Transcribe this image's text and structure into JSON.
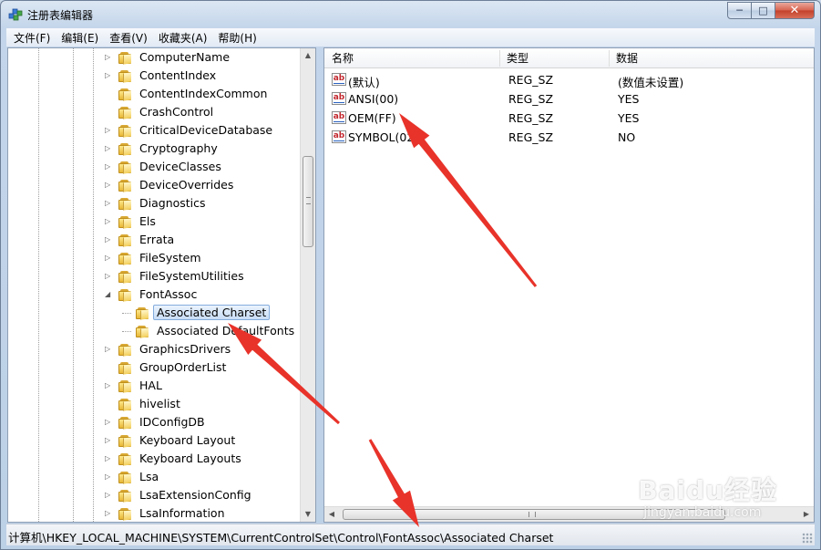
{
  "window": {
    "title": "注册表编辑器"
  },
  "menubar": [
    {
      "label": "文件(F)"
    },
    {
      "label": "编辑(E)"
    },
    {
      "label": "查看(V)"
    },
    {
      "label": "收藏夹(A)"
    },
    {
      "label": "帮助(H)"
    }
  ],
  "tree": {
    "items": [
      {
        "label": "ComputerName",
        "depth": 0,
        "expander": "collapsed"
      },
      {
        "label": "ContentIndex",
        "depth": 0,
        "expander": "collapsed"
      },
      {
        "label": "ContentIndexCommon",
        "depth": 0,
        "expander": "none"
      },
      {
        "label": "CrashControl",
        "depth": 0,
        "expander": "none"
      },
      {
        "label": "CriticalDeviceDatabase",
        "depth": 0,
        "expander": "collapsed"
      },
      {
        "label": "Cryptography",
        "depth": 0,
        "expander": "collapsed"
      },
      {
        "label": "DeviceClasses",
        "depth": 0,
        "expander": "collapsed"
      },
      {
        "label": "DeviceOverrides",
        "depth": 0,
        "expander": "collapsed"
      },
      {
        "label": "Diagnostics",
        "depth": 0,
        "expander": "collapsed"
      },
      {
        "label": "Els",
        "depth": 0,
        "expander": "collapsed"
      },
      {
        "label": "Errata",
        "depth": 0,
        "expander": "collapsed"
      },
      {
        "label": "FileSystem",
        "depth": 0,
        "expander": "collapsed"
      },
      {
        "label": "FileSystemUtilities",
        "depth": 0,
        "expander": "collapsed"
      },
      {
        "label": "FontAssoc",
        "depth": 0,
        "expander": "expanded"
      },
      {
        "label": "Associated Charset",
        "depth": 1,
        "expander": "none",
        "selected": true
      },
      {
        "label": "Associated DefaultFonts",
        "depth": 1,
        "expander": "none"
      },
      {
        "label": "GraphicsDrivers",
        "depth": 0,
        "expander": "collapsed"
      },
      {
        "label": "GroupOrderList",
        "depth": 0,
        "expander": "none"
      },
      {
        "label": "HAL",
        "depth": 0,
        "expander": "collapsed"
      },
      {
        "label": "hivelist",
        "depth": 0,
        "expander": "none"
      },
      {
        "label": "IDConfigDB",
        "depth": 0,
        "expander": "collapsed"
      },
      {
        "label": "Keyboard Layout",
        "depth": 0,
        "expander": "collapsed"
      },
      {
        "label": "Keyboard Layouts",
        "depth": 0,
        "expander": "collapsed"
      },
      {
        "label": "Lsa",
        "depth": 0,
        "expander": "collapsed"
      },
      {
        "label": "LsaExtensionConfig",
        "depth": 0,
        "expander": "collapsed"
      },
      {
        "label": "LsaInformation",
        "depth": 0,
        "expander": "collapsed"
      }
    ]
  },
  "values": {
    "columns": {
      "name": "名称",
      "type": "类型",
      "data": "数据"
    },
    "rows": [
      {
        "name": "(默认)",
        "type": "REG_SZ",
        "data": "(数值未设置)"
      },
      {
        "name": "ANSI(00)",
        "type": "REG_SZ",
        "data": "YES"
      },
      {
        "name": "OEM(FF)",
        "type": "REG_SZ",
        "data": "YES"
      },
      {
        "name": "SYMBOL(02)",
        "type": "REG_SZ",
        "data": "NO"
      }
    ],
    "icon_text": "ab"
  },
  "statusbar": {
    "path": "计算机\\HKEY_LOCAL_MACHINE\\SYSTEM\\CurrentControlSet\\Control\\FontAssoc\\Associated Charset"
  },
  "watermark": {
    "brand": "Baidu经验",
    "url": "jingyan.baidu.com"
  },
  "colors": {
    "annotation_arrow": "#e8332a",
    "selection": "#c8ddf6",
    "value_icon_text": "#c2272d"
  }
}
